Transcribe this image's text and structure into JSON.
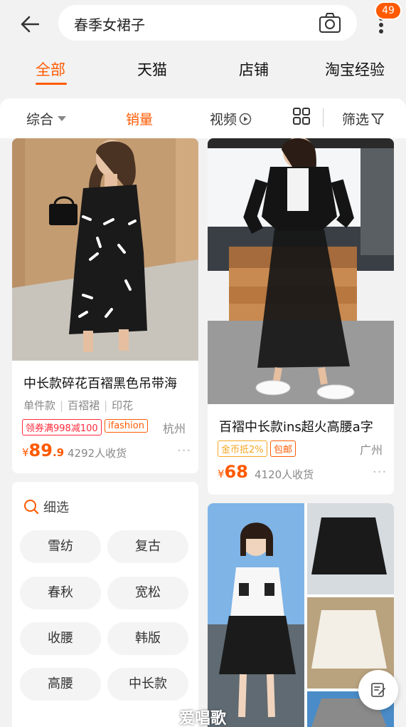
{
  "header": {
    "search_query": "春季女裙子",
    "notification_count": "49"
  },
  "tabs": [
    {
      "label": "全部",
      "active": true
    },
    {
      "label": "天猫",
      "active": false
    },
    {
      "label": "店铺",
      "active": false
    },
    {
      "label": "淘宝经验",
      "active": false
    }
  ],
  "filters": {
    "comprehensive": "综合",
    "sales": "销量",
    "video": "视频",
    "filter": "筛选",
    "active_color": "#ff5a00"
  },
  "products": [
    {
      "title": "中长款碎花百褶黑色吊带海",
      "tags": [
        "单件款",
        "百褶裙",
        "印花"
      ],
      "promos": [
        "领券满998减100",
        "ifashion"
      ],
      "city": "杭州",
      "price_currency": "¥",
      "price_int": "89",
      "price_dec": ".9",
      "sold": "4292人收货"
    },
    {
      "title": "百褶中长款ins超火高腰a字",
      "promos": [
        "金币抵2%",
        "包邮"
      ],
      "city": "广州",
      "price_currency": "¥",
      "price_int": "68",
      "sold": "4120人收货"
    }
  ],
  "refine": {
    "title": "细选",
    "chips": [
      "雪纺",
      "复古",
      "春秋",
      "宽松",
      "收腰",
      "韩版",
      "高腰",
      "中长款"
    ]
  },
  "watermark": "爱唱歌"
}
